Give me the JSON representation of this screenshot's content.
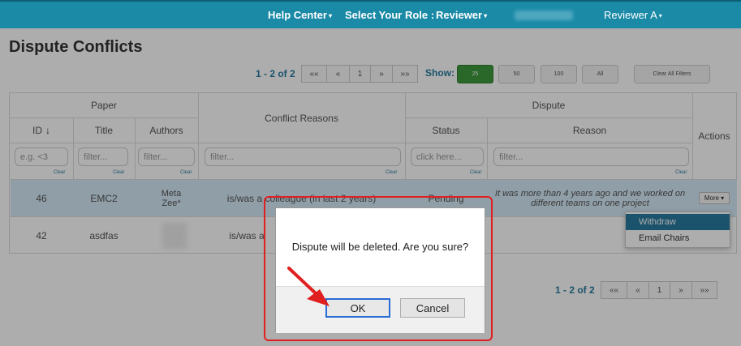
{
  "nav": {
    "help_center": "Help Center",
    "select_role_label": "Select Your Role :",
    "role_value": "Reviewer",
    "user_name": "Reviewer A",
    "caret": "▾"
  },
  "page": {
    "title": "Dispute Conflicts"
  },
  "pager": {
    "count_text": "1 - 2 of 2",
    "first": "««",
    "prev": "«",
    "page": "1",
    "next": "»",
    "last": "»»",
    "show_label": "Show:",
    "show_options": [
      "25",
      "50",
      "100",
      "All"
    ],
    "show_selected": "25",
    "clear_all": "Clear All Filters"
  },
  "table": {
    "group_headers": {
      "paper": "Paper",
      "dispute": "Dispute"
    },
    "columns": {
      "id": "ID",
      "id_sort_icon": "↓",
      "title": "Title",
      "authors": "Authors",
      "conflict_reasons": "Conflict Reasons",
      "status": "Status",
      "reason": "Reason",
      "actions": "Actions"
    },
    "filters": {
      "id_placeholder": "e.g. <3",
      "title_placeholder": "filter...",
      "authors_placeholder": "filter...",
      "conflict_placeholder": "filter...",
      "status_placeholder": "click here...",
      "reason_placeholder": "filter...",
      "clear": "Clear"
    },
    "rows": [
      {
        "id": "46",
        "title": "EMC2",
        "authors": "Meta Zee*",
        "conflict_reason": "is/was a colleague (in last 2 years)",
        "status": "Pending",
        "reason": "It was more than 4 years ago and we worked on different teams on one project",
        "action": "More"
      },
      {
        "id": "42",
        "title": "asdfas",
        "authors": "",
        "conflict_reason": "is/was a",
        "status": "",
        "reason": "",
        "action": ""
      }
    ]
  },
  "actions_menu": {
    "items": [
      "Withdraw",
      "Email Chairs"
    ],
    "highlighted": "Withdraw"
  },
  "dialog": {
    "message": "Dispute will be deleted. Are you sure?",
    "ok_label": "OK",
    "cancel_label": "Cancel"
  },
  "colors": {
    "nav_bg": "#1a8aa7",
    "accent": "#2a7ba0",
    "selected_row": "#d4e9f7",
    "active_show": "#3d9a3d",
    "annotation_red": "#e02020"
  }
}
